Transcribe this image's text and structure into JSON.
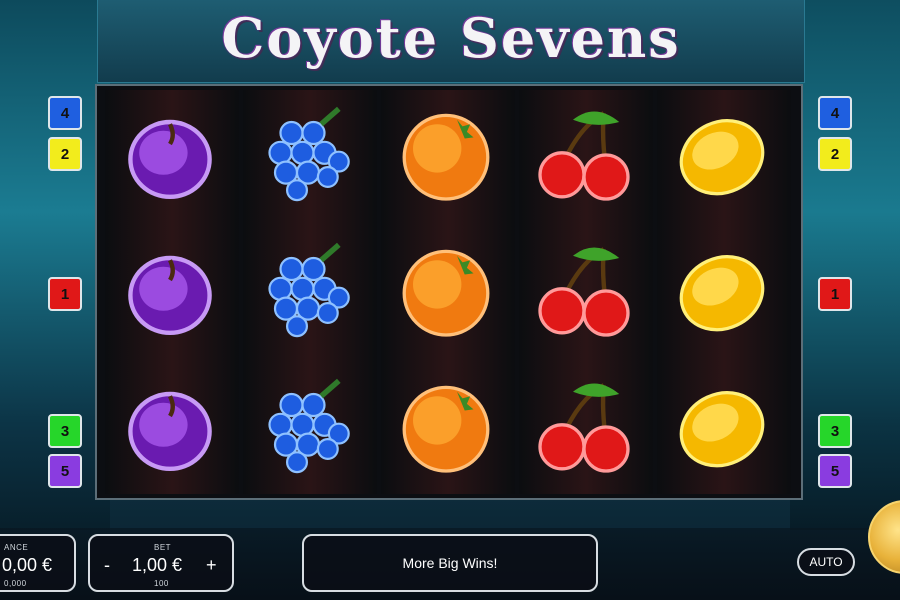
{
  "game": {
    "title": "Coyote Sevens"
  },
  "paylines": {
    "left": [
      {
        "label": "4",
        "color": "#1f5fe0"
      },
      {
        "label": "2",
        "color": "#f2ec1c"
      },
      {
        "label": "1",
        "color": "#e01818"
      },
      {
        "label": "3",
        "color": "#26d62a"
      },
      {
        "label": "5",
        "color": "#8a3ce0"
      }
    ],
    "right": [
      {
        "label": "4",
        "color": "#1f5fe0"
      },
      {
        "label": "2",
        "color": "#f2ec1c"
      },
      {
        "label": "1",
        "color": "#e01818"
      },
      {
        "label": "3",
        "color": "#26d62a"
      },
      {
        "label": "5",
        "color": "#8a3ce0"
      }
    ]
  },
  "reels": [
    [
      "plum",
      "plum",
      "plum"
    ],
    [
      "grapes",
      "grapes",
      "grapes"
    ],
    [
      "orange",
      "orange",
      "orange"
    ],
    [
      "cherries",
      "cherries",
      "cherries"
    ],
    [
      "lemon",
      "lemon",
      "lemon"
    ]
  ],
  "balance": {
    "label": "ANCE",
    "value": "0,00 €",
    "sub": "0,000"
  },
  "bet": {
    "label": "BET",
    "value": "1,00 €",
    "sub": "100",
    "minus": "-",
    "plus": "+"
  },
  "message": "More Big Wins!",
  "auto_label": "AUTO"
}
